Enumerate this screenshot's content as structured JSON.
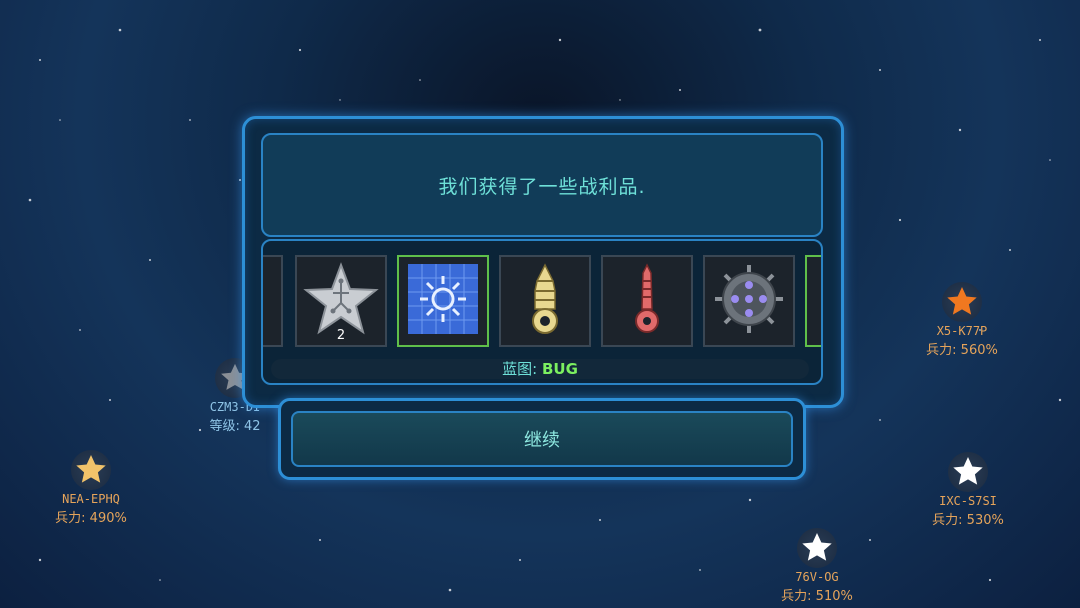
{
  "dialog": {
    "message": "我们获得了一些战利品.",
    "caption_label": "蓝图:",
    "caption_value": "BUG",
    "continue_label": "继续",
    "loot_items": [
      {
        "name": "partial-purple-item",
        "icon": "purple-shard-icon"
      },
      {
        "name": "circuit-star-item",
        "icon": "circuit-star-icon",
        "count": "2"
      },
      {
        "name": "blueprint-gear-item",
        "icon": "blueprint-gear-icon",
        "selected": true
      },
      {
        "name": "yellow-drill-item",
        "icon": "yellow-drill-icon"
      },
      {
        "name": "red-drill-item",
        "icon": "red-drill-icon"
      },
      {
        "name": "spiked-mine-item",
        "icon": "spiked-mine-icon"
      },
      {
        "name": "partial-green-item",
        "icon": "partial-item-icon"
      }
    ]
  },
  "map_nodes": [
    {
      "code": "CZM3-DI",
      "stat_label": "等级:",
      "stat_value": "42",
      "color": "#8fc4e6",
      "star_color": "#8a8f96"
    },
    {
      "code": "X5-K77P",
      "stat_label": "兵力:",
      "stat_value": "560%",
      "color": "#e6a45a",
      "star_color": "#f07820"
    },
    {
      "code": "NEA-EPHQ",
      "stat_label": "兵力:",
      "stat_value": "490%",
      "color": "#e6a45a",
      "star_color": "#f2c36a"
    },
    {
      "code": "IXC-S7SI",
      "stat_label": "兵力:",
      "stat_value": "530%",
      "color": "#e6a45a",
      "star_color": "#ffffff"
    },
    {
      "code": "76V-OG",
      "stat_label": "兵力:",
      "stat_value": "510%",
      "color": "#e6a45a",
      "star_color": "#ffffff"
    }
  ],
  "colors": {
    "frame": "#2d8fd6",
    "text_cyan": "#6ee0d8",
    "highlight_green": "#7cf060"
  }
}
